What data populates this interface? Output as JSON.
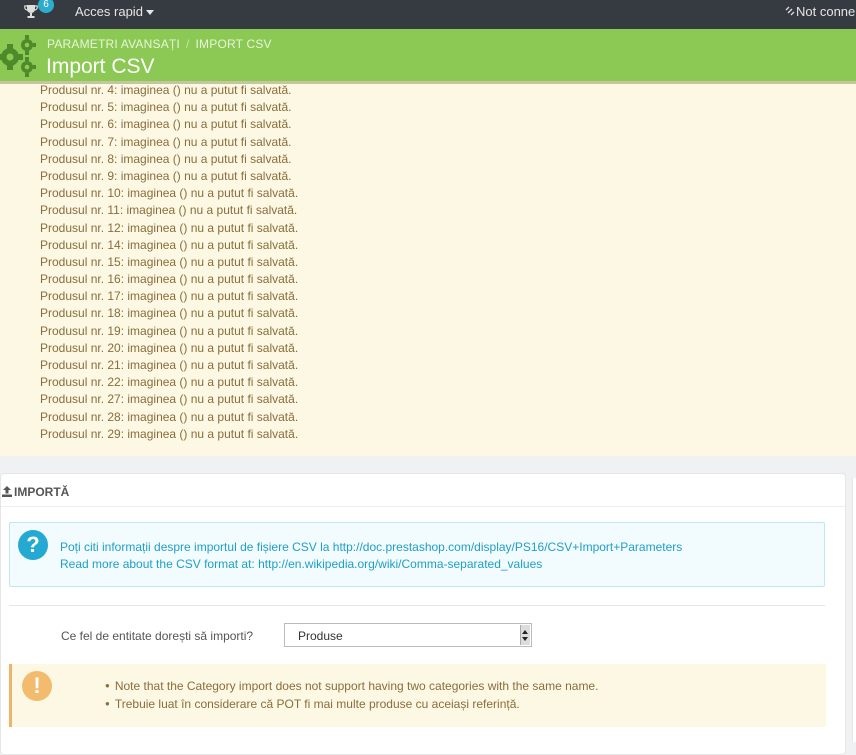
{
  "topbar": {
    "badge_count": "6",
    "quick_access": "Acces rapid",
    "connection_status": "Not conne",
    "trophy_icon": "trophy-icon",
    "disconnected_icon": "unlink-icon"
  },
  "header": {
    "breadcrumb": [
      "PARAMETRI AVANSAȚI",
      "IMPORT CSV"
    ],
    "title": "Import CSV",
    "color": "#8bc954"
  },
  "warnings": [
    "Produsul nr. 4: imaginea () nu a putut fi salvată.",
    "Produsul nr. 5: imaginea () nu a putut fi salvată.",
    "Produsul nr. 6: imaginea () nu a putut fi salvată.",
    "Produsul nr. 7: imaginea () nu a putut fi salvată.",
    "Produsul nr. 8: imaginea () nu a putut fi salvată.",
    "Produsul nr. 9: imaginea () nu a putut fi salvată.",
    "Produsul nr. 10: imaginea () nu a putut fi salvată.",
    "Produsul nr. 11: imaginea () nu a putut fi salvată.",
    "Produsul nr. 12: imaginea () nu a putut fi salvată.",
    "Produsul nr. 14: imaginea () nu a putut fi salvată.",
    "Produsul nr. 15: imaginea () nu a putut fi salvată.",
    "Produsul nr. 16: imaginea () nu a putut fi salvată.",
    "Produsul nr. 17: imaginea () nu a putut fi salvată.",
    "Produsul nr. 18: imaginea () nu a putut fi salvată.",
    "Produsul nr. 19: imaginea () nu a putut fi salvată.",
    "Produsul nr. 20: imaginea () nu a putut fi salvată.",
    "Produsul nr. 21: imaginea () nu a putut fi salvată.",
    "Produsul nr. 22: imaginea () nu a putut fi salvată.",
    "Produsul nr. 27: imaginea () nu a putut fi salvată.",
    "Produsul nr. 28: imaginea () nu a putut fi salvată.",
    "Produsul nr. 29: imaginea () nu a putut fi salvată."
  ],
  "panel": {
    "title": "IMPORTĂ",
    "info_line1": "Poți citi informații despre importul de fișiere CSV la http://doc.prestashop.com/display/PS16/CSV+Import+Parameters",
    "info_line2": "Read more about the CSV format at: http://en.wikipedia.org/wiki/Comma-separated_values",
    "entity_label": "Ce fel de entitate dorești să importi?",
    "entity_value": "Produse",
    "notes": [
      "Note that the Category import does not support having two categories with the same name.",
      "Trebuie luat în considerare că POT fi mai multe produse cu aceiași referință."
    ]
  }
}
